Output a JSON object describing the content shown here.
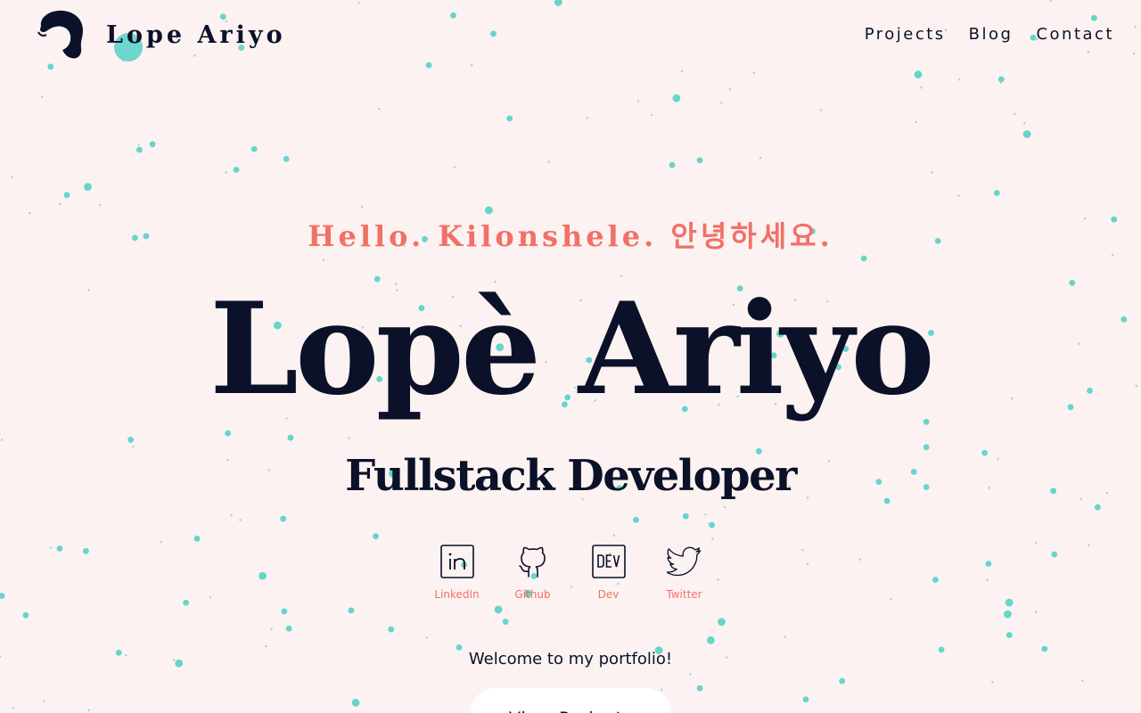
{
  "header": {
    "brand": "Lope Ariyo",
    "nav": [
      {
        "label": "Projects"
      },
      {
        "label": "Blog"
      },
      {
        "label": "Contact"
      }
    ]
  },
  "hero": {
    "greeting": "Hello. Kilonshele. 안녕하세요.",
    "name": "Lopè Ariyo",
    "role": "Fullstack Developer",
    "welcome": "Welcome to my portfolio!",
    "cta_label": "View Projects"
  },
  "socials": [
    {
      "label": "LinkedIn",
      "icon": "linkedin-icon"
    },
    {
      "label": "Github",
      "icon": "github-icon"
    },
    {
      "label": "Dev",
      "icon": "dev-icon"
    },
    {
      "label": "Twitter",
      "icon": "twitter-icon"
    }
  ],
  "colors": {
    "background": "#fcf2f1",
    "ink": "#0a1128",
    "accent": "#f07167",
    "particles": "#5ed3c8"
  }
}
